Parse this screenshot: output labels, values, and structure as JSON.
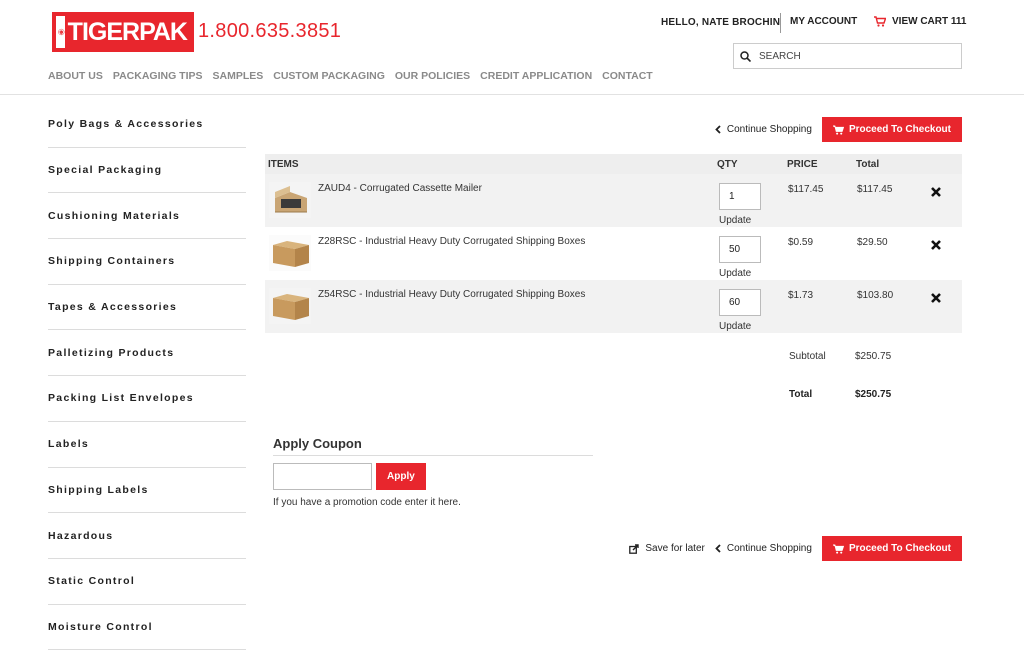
{
  "brand": {
    "logo_text": "TIGERPAK",
    "phone": "1.800.635.3851"
  },
  "nav": [
    "ABOUT US",
    "PACKAGING TIPS",
    "SAMPLES",
    "CUSTOM PACKAGING",
    "OUR POLICIES",
    "CREDIT APPLICATION",
    "CONTACT"
  ],
  "account": {
    "greeting": "HELLO, NATE BROCHIN",
    "my_account": "MY ACCOUNT",
    "view_cart": "VIEW CART 111"
  },
  "search": {
    "placeholder": "SEARCH"
  },
  "sidebar": {
    "items": [
      "Poly Bags & Accessories",
      "Special Packaging",
      "Cushioning Materials",
      "Shipping Containers",
      "Tapes & Accessories",
      "Palletizing Products",
      "Packing List Envelopes",
      "Labels",
      "Shipping Labels",
      "Hazardous",
      "Static Control",
      "Moisture Control"
    ]
  },
  "actions": {
    "continue_shopping": "Continue Shopping",
    "checkout": "Proceed To Checkout",
    "save_for_later": "Save for later"
  },
  "cart": {
    "headers": {
      "items": "ITEMS",
      "qty": "QTY",
      "price": "PRICE",
      "total": "Total"
    },
    "update_label": "Update",
    "rows": [
      {
        "name": "ZAUD4 - Corrugated Cassette Mailer",
        "qty": "1",
        "price": "$117.45",
        "total": "$117.45"
      },
      {
        "name": "Z28RSC - Industrial Heavy Duty Corrugated Shipping Boxes",
        "qty": "50",
        "price": "$0.59",
        "total": "$29.50"
      },
      {
        "name": "Z54RSC - Industrial Heavy Duty Corrugated Shipping Boxes",
        "qty": "60",
        "price": "$1.73",
        "total": "$103.80"
      }
    ],
    "subtotal_label": "Subtotal",
    "subtotal": "$250.75",
    "total_label": "Total",
    "total": "$250.75"
  },
  "coupon": {
    "title": "Apply Coupon",
    "button": "Apply",
    "help": "If you have a promotion code enter it here."
  },
  "colors": {
    "accent": "#e8262d"
  }
}
